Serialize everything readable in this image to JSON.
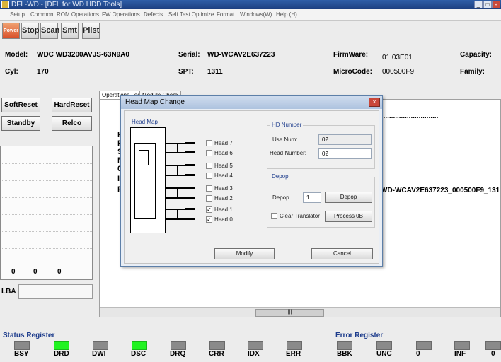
{
  "window": {
    "title": "DFL-WD - [DFL for WD HDD Tools]",
    "controls": {
      "minimize": "_",
      "maximize": "□",
      "close": "×"
    }
  },
  "menu": [
    "Setup",
    "Common",
    "ROM Operations",
    "FW Operations",
    "Defects",
    "Self Test Optimize",
    "Format",
    "Windows(W)",
    "Help (H)"
  ],
  "toolbar": {
    "power": "Power",
    "stop": "Stop",
    "scan": "Scan",
    "smt": "Smt",
    "plist": "Plist"
  },
  "drive": {
    "model_label": "Model:",
    "model": "WDC WD3200AVJS-63N9A0",
    "serial_label": "Serial:",
    "serial": "WD-WCAV2E637223",
    "firmware_label": "FirmWare:",
    "firmware": "01.03E01",
    "capacity_label": "Capacity:",
    "cyl_label": "Cyl:",
    "cyl": "170",
    "spt_label": "SPT:",
    "spt": "1311",
    "microcode_label": "MicroCode:",
    "microcode": "000500F9",
    "family_label": "Family:"
  },
  "left_buttons": {
    "softreset": "SoftReset",
    "hardreset": "HardReset",
    "standby": "Standby",
    "relco": "Relco"
  },
  "counters": [
    "0",
    "0",
    "0"
  ],
  "lba_label": "LBA",
  "tabs": [
    "Operations Log",
    "Module Check"
  ],
  "log": {
    "dots": "..............................",
    "fragments": [
      "H",
      "P",
      "S",
      "M",
      "0",
      "In",
      "F"
    ],
    "serial_line": "WD-WCAV2E637223_000500F9_131"
  },
  "scroll_thumb": "|||",
  "dialog": {
    "title": "Head Map Change",
    "close": "×",
    "head_map_title": "Head Map",
    "heads": [
      {
        "label": "Head 7",
        "checked": false
      },
      {
        "label": "Head 6",
        "checked": false
      },
      {
        "label": "Head 5",
        "checked": false
      },
      {
        "label": "Head 4",
        "checked": false
      },
      {
        "label": "Head 3",
        "checked": false
      },
      {
        "label": "Head 2",
        "checked": false
      },
      {
        "label": "Head 1",
        "checked": true
      },
      {
        "label": "Head 0",
        "checked": true
      }
    ],
    "check_mark": "✓",
    "hd_number_title": "HD Number",
    "use_num_label": "Use Num:",
    "use_num": "02",
    "head_number_label": "Head Number:",
    "head_number": "02",
    "depop_title": "Depop",
    "depop_label": "Depop",
    "depop_value": "1",
    "depop_button": "Depop",
    "clear_translator_label": "Clear Translator",
    "process_button": "Process 0B",
    "modify_button": "Modify",
    "cancel_button": "Cancel"
  },
  "status_register": {
    "title": "Status Register",
    "leds": [
      {
        "label": "BSY",
        "on": false
      },
      {
        "label": "DRD",
        "on": true
      },
      {
        "label": "DWI",
        "on": false
      },
      {
        "label": "DSC",
        "on": true
      },
      {
        "label": "DRQ",
        "on": false
      },
      {
        "label": "CRR",
        "on": false
      },
      {
        "label": "IDX",
        "on": false
      },
      {
        "label": "ERR",
        "on": false
      }
    ]
  },
  "error_register": {
    "title": "Error Register",
    "leds": [
      {
        "label": "BBK",
        "on": false
      },
      {
        "label": "UNC",
        "on": false
      },
      {
        "label": "0",
        "on": false
      },
      {
        "label": "INF",
        "on": false
      },
      {
        "label": "0",
        "on": false
      }
    ]
  },
  "colors": {
    "led_on": "#21f321",
    "led_off": "#8a8a8a",
    "titlebar": "#2f5ea8",
    "group_title": "#1d3c8c"
  }
}
